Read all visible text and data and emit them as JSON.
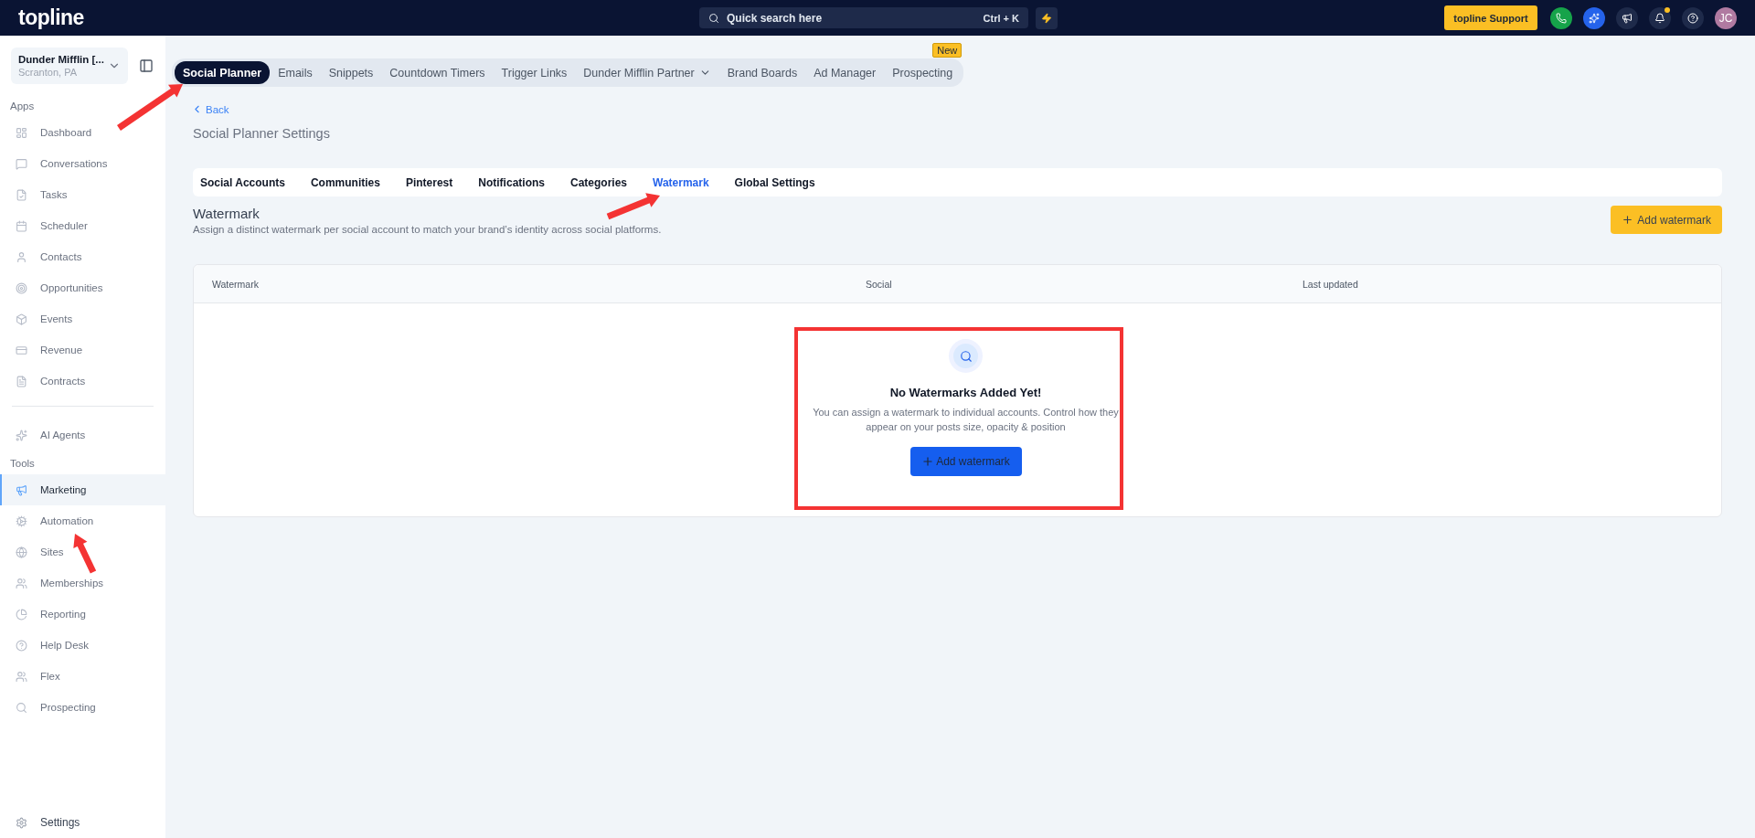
{
  "topbar": {
    "logo": "topline",
    "search": {
      "placeholder": "Quick search here",
      "shortcut": "Ctrl + K"
    },
    "support": "topline Support",
    "avatar": "JC",
    "notification_dot": true
  },
  "sidebar": {
    "account": {
      "name": "Dunder Mifflin [...",
      "location": "Scranton, PA"
    },
    "sections": [
      {
        "label": "Apps",
        "items": [
          {
            "label": "Dashboard",
            "selected": false
          },
          {
            "label": "Conversations",
            "selected": false
          },
          {
            "label": "Tasks",
            "selected": false
          },
          {
            "label": "Scheduler",
            "selected": false
          },
          {
            "label": "Contacts",
            "selected": false
          },
          {
            "label": "Opportunities",
            "selected": false
          },
          {
            "label": "Events",
            "selected": false
          },
          {
            "label": "Revenue",
            "selected": false
          },
          {
            "label": "Contracts",
            "selected": false
          }
        ]
      },
      {
        "items": [
          {
            "label": "AI Agents",
            "selected": false
          }
        ]
      },
      {
        "label": "Tools",
        "items": [
          {
            "label": "Marketing",
            "selected": true
          },
          {
            "label": "Automation",
            "selected": false
          },
          {
            "label": "Sites",
            "selected": false
          },
          {
            "label": "Memberships",
            "selected": false
          },
          {
            "label": "Reporting",
            "selected": false
          },
          {
            "label": "Help Desk",
            "selected": false
          },
          {
            "label": "Flex",
            "selected": false
          },
          {
            "label": "Prospecting",
            "selected": false
          }
        ]
      }
    ],
    "footer": "Settings"
  },
  "top_tabs": [
    {
      "label": "Social Planner",
      "selected": true
    },
    {
      "label": "Emails",
      "selected": false
    },
    {
      "label": "Snippets",
      "selected": false
    },
    {
      "label": "Countdown Timers",
      "selected": false
    },
    {
      "label": "Trigger Links",
      "selected": false
    },
    {
      "label": "Dunder Mifflin Partner",
      "selected": false,
      "dropdown": true
    },
    {
      "label": "Brand Boards",
      "selected": false
    },
    {
      "label": "Ad Manager",
      "selected": false
    },
    {
      "label": "Prospecting",
      "selected": false,
      "badge": "New"
    }
  ],
  "back": "Back",
  "page_title": "Social Planner Settings",
  "settings_tabs": [
    {
      "label": "Social Accounts",
      "selected": false
    },
    {
      "label": "Communities",
      "selected": false
    },
    {
      "label": "Pinterest",
      "selected": false
    },
    {
      "label": "Notifications",
      "selected": false
    },
    {
      "label": "Categories",
      "selected": false
    },
    {
      "label": "Watermark",
      "selected": true
    },
    {
      "label": "Global Settings",
      "selected": false
    }
  ],
  "section": {
    "title": "Watermark",
    "description": "Assign a distinct watermark per social account to match your brand’s identity across social platforms.",
    "add_button": "Add watermark"
  },
  "table": {
    "columns": [
      "Watermark",
      "Social",
      "Last updated"
    ],
    "empty": {
      "title": "No Watermarks Added Yet!",
      "text": "You can assign a watermark to individual accounts. Control how they appear on your posts size, opacity & position",
      "button": "Add watermark"
    }
  },
  "annotations": [
    {
      "kind": "arrow"
    },
    {
      "kind": "arrow"
    },
    {
      "kind": "arrow"
    },
    {
      "kind": "frame"
    }
  ]
}
